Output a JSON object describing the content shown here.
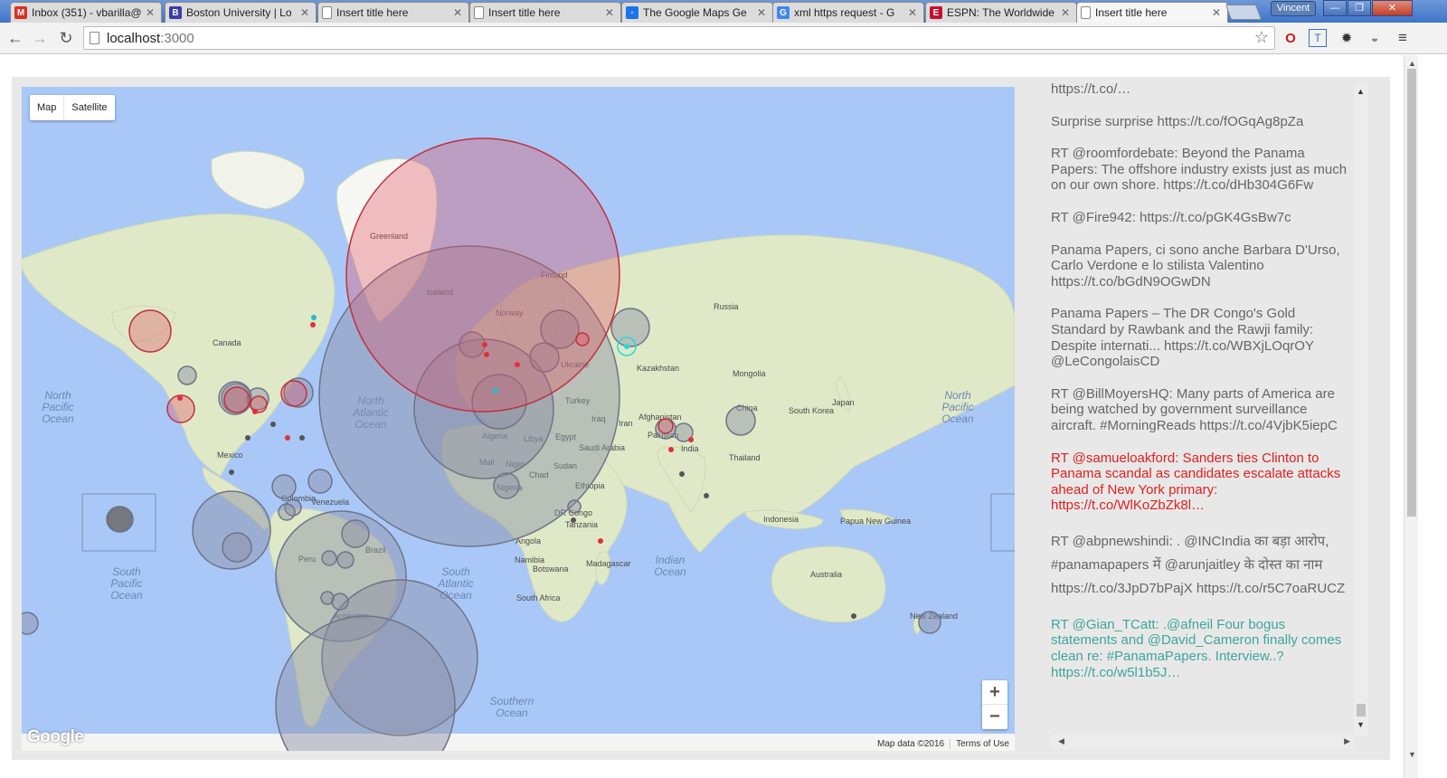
{
  "browser": {
    "tabs": [
      {
        "title": "Inbox (351) - vbarilla@",
        "favicon": "gmail-icon",
        "color": "#d93025",
        "glyph": "M",
        "active": false
      },
      {
        "title": "Boston University | Lo",
        "favicon": "bu-icon",
        "color": "#3b3ea8",
        "glyph": "B",
        "active": false
      },
      {
        "title": "Insert title here",
        "favicon": "page-icon",
        "color": "",
        "glyph": "",
        "active": false
      },
      {
        "title": "Insert title here",
        "favicon": "page-icon",
        "color": "",
        "glyph": "",
        "active": false
      },
      {
        "title": "The Google Maps Ge",
        "favicon": "google-dev-icon",
        "color": "#1a73e8",
        "glyph": "◦",
        "active": false
      },
      {
        "title": "xml https request - G",
        "favicon": "google-icon",
        "color": "#4285f4",
        "glyph": "G",
        "active": false
      },
      {
        "title": "ESPN: The Worldwide",
        "favicon": "espn-icon",
        "color": "#c8102e",
        "glyph": "E",
        "active": false
      },
      {
        "title": "Insert title here",
        "favicon": "page-icon",
        "color": "",
        "glyph": "",
        "active": true
      }
    ],
    "user": "Vincent",
    "url_host": "localhost",
    "url_port": ":3000"
  },
  "map": {
    "type_map": "Map",
    "type_satellite": "Satellite",
    "zoom_in": "+",
    "zoom_out": "−",
    "logo": "Google",
    "map_data": "Map data ©2016",
    "terms": "Terms of Use",
    "labels": [
      {
        "text": "Greenland",
        "cls": "land"
      },
      {
        "text": "Canada",
        "cls": "land"
      },
      {
        "text": "Finland",
        "cls": "land"
      },
      {
        "text": "Iceland",
        "cls": "land"
      },
      {
        "text": "Norway",
        "cls": "land"
      },
      {
        "text": "Russia",
        "cls": "land"
      },
      {
        "text": "Ukraine",
        "cls": "land"
      },
      {
        "text": "Kazakhstan",
        "cls": "land"
      },
      {
        "text": "Mongolia",
        "cls": "land"
      },
      {
        "text": "Turkey",
        "cls": "land"
      },
      {
        "text": "Iraq",
        "cls": "land"
      },
      {
        "text": "Iran",
        "cls": "land"
      },
      {
        "text": "Afghanistan",
        "cls": "land"
      },
      {
        "text": "Pakistan",
        "cls": "land"
      },
      {
        "text": "China",
        "cls": "land"
      },
      {
        "text": "Japan",
        "cls": "land"
      },
      {
        "text": "South Korea",
        "cls": "land"
      },
      {
        "text": "India",
        "cls": "land"
      },
      {
        "text": "Thailand",
        "cls": "land"
      },
      {
        "text": "Saudi Arabia",
        "cls": "land"
      },
      {
        "text": "Egypt",
        "cls": "land"
      },
      {
        "text": "Libya",
        "cls": "land"
      },
      {
        "text": "Algeria",
        "cls": "land"
      },
      {
        "text": "Mali",
        "cls": "land"
      },
      {
        "text": "Niger",
        "cls": "land"
      },
      {
        "text": "Chad",
        "cls": "land"
      },
      {
        "text": "Sudan",
        "cls": "land"
      },
      {
        "text": "Ethiopia",
        "cls": "land"
      },
      {
        "text": "Nigeria",
        "cls": "land"
      },
      {
        "text": "DR Congo",
        "cls": "land"
      },
      {
        "text": "Tanzania",
        "cls": "land"
      },
      {
        "text": "Angola",
        "cls": "land"
      },
      {
        "text": "Namibia",
        "cls": "land"
      },
      {
        "text": "Botswana",
        "cls": "land"
      },
      {
        "text": "South Africa",
        "cls": "land"
      },
      {
        "text": "Madagascar",
        "cls": "land"
      },
      {
        "text": "Indonesia",
        "cls": "land"
      },
      {
        "text": "Papua New Guinea",
        "cls": "land"
      },
      {
        "text": "Australia",
        "cls": "land"
      },
      {
        "text": "New Zealand",
        "cls": "land"
      },
      {
        "text": "Mexico",
        "cls": "land"
      },
      {
        "text": "Colombia",
        "cls": "land"
      },
      {
        "text": "Venezuela",
        "cls": "land"
      },
      {
        "text": "Peru",
        "cls": "land"
      },
      {
        "text": "Brazil",
        "cls": "land"
      },
      {
        "text": "Argentina",
        "cls": "land"
      },
      {
        "text": "North Pacific Ocean",
        "cls": "ocean"
      },
      {
        "text": "North Pacific Ocean",
        "cls": "ocean"
      },
      {
        "text": "North Atlantic Ocean",
        "cls": "ocean"
      },
      {
        "text": "South Pacific Ocean",
        "cls": "ocean"
      },
      {
        "text": "South Atlantic Ocean",
        "cls": "ocean"
      },
      {
        "text": "Indian Ocean",
        "cls": "ocean"
      },
      {
        "text": "Southern Ocean",
        "cls": "ocean"
      }
    ],
    "colors": {
      "ocean": "#a9c8f7",
      "land": "#dfe9c7",
      "ice": "#ffffff",
      "red_circle": "#e05060",
      "gray_circle": "#8a8fa5"
    }
  },
  "feed": [
    {
      "text": "https://t.co/…",
      "style": "gray"
    },
    {
      "text": "Surprise surprise https://t.co/fOGqAg8pZa",
      "style": "gray"
    },
    {
      "text": "RT @roomfordebate: Beyond the Panama Papers: The offshore industry exists just as much on our own shore. https://t.co/dHb304G6Fw",
      "style": "gray"
    },
    {
      "text": "RT @Fire942: https://t.co/pGK4GsBw7c",
      "style": "gray"
    },
    {
      "text": "Panama Papers, ci sono anche Barbara D'Urso, Carlo Verdone e lo stilista Valentino https://t.co/bGdN9OGwDN",
      "style": "gray"
    },
    {
      "text": "Panama Papers – The DR Congo's Gold Standard by Rawbank and the Rawji family: Despite internati... https://t.co/WBXjLOqrOY @LeCongolaisCD",
      "style": "gray"
    },
    {
      "text": "RT @BillMoyersHQ: Many parts of America are being watched by government surveillance aircraft. #MorningReads https://t.co/4VjbK5iepC",
      "style": "gray"
    },
    {
      "text": "RT @samueloakford: Sanders ties Clinton to Panama scandal as candidates escalate attacks ahead of New York primary: https://t.co/WlKoZbZk8l…",
      "style": "red"
    },
    {
      "text": "RT @abpnewshindi: . @INCIndia का बड़ा आरोप, #panamapapers में @arunjaitley के दोस्त का नाम https://t.co/3JpD7bPajX https://t.co/r5C7oaRUCZ",
      "style": "hindi"
    },
    {
      "text": "RT @Gian_TCatt: .@afneil Four bogus statements and @David_Cameron finally comes clean re: #PanamaPapers. Interview..? https://t.co/w5l1b5J…",
      "style": "teal"
    }
  ]
}
